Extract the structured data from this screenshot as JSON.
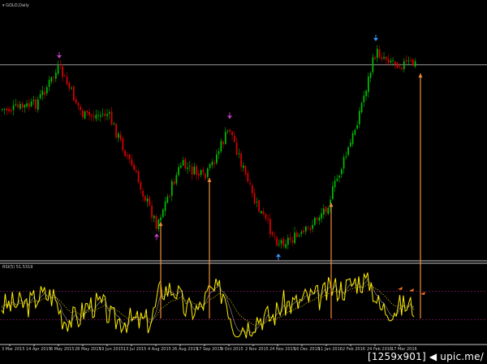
{
  "chart_data": [
    {
      "type": "candlestick",
      "symbol_label": "GOLD,Daily",
      "background": "#000000",
      "up_color": "#00c000",
      "down_color": "#e00000",
      "level_line_color": "#9a9a9a",
      "annotation_line_color": "#f08a3a",
      "x_tick_labels": [
        "3 Mar 2015",
        "14 Apr 2015",
        "6 May 2015",
        "28 May 2015",
        "19 Jun 2015",
        "13 Jul 2015",
        "4 Aug 2015",
        "26 Aug 2015",
        "17 Sep 2015",
        "9 Oct 2015",
        "2 Nov 2015",
        "24 Nov 2015",
        "16 Dec 2015",
        "11 Jan 2016",
        "2 Feb 2016",
        "24 Feb 2016",
        "17 Mar 2016"
      ],
      "close_path": [
        {
          "d": "3 Mar 2015",
          "c": 0.6
        },
        {
          "d": "14 Apr 2015",
          "c": 0.62
        },
        {
          "d": "6 May 2015",
          "c": 0.78
        },
        {
          "d": "28 May 2015",
          "c": 0.57
        },
        {
          "d": "19 Jun 2015",
          "c": 0.58
        },
        {
          "d": "13 Jul 2015",
          "c": 0.35
        },
        {
          "d": "4 Aug 2015",
          "c": 0.1
        },
        {
          "d": "26 Aug 2015",
          "c": 0.36
        },
        {
          "d": "17 Sep 2015",
          "c": 0.3
        },
        {
          "d": "9 Oct 2015",
          "c": 0.52
        },
        {
          "d": "2 Nov 2015",
          "c": 0.2
        },
        {
          "d": "24 Nov 2015",
          "c": 0.02
        },
        {
          "d": "16 Dec 2015",
          "c": 0.05
        },
        {
          "d": "11 Jan 2016",
          "c": 0.18
        },
        {
          "d": "2 Feb 2016",
          "c": 0.46
        },
        {
          "d": "24 Feb 2016",
          "c": 0.85
        },
        {
          "d": "17 Mar 2016",
          "c": 0.8
        }
      ],
      "swing_arrows": [
        {
          "d": "6 May 2015",
          "kind": "down",
          "color": "#c040c0"
        },
        {
          "d": "4 Aug 2015",
          "kind": "up",
          "color": "#c040c0"
        },
        {
          "d": "9 Oct 2015",
          "kind": "down",
          "color": "#c040c0"
        },
        {
          "d": "24 Nov 2015",
          "kind": "up",
          "color": "#3399ff"
        },
        {
          "d": "24 Feb 2016",
          "kind": "down",
          "color": "#3399ff"
        }
      ]
    },
    {
      "type": "line",
      "indicator_label": "RSI(5) 51.5319",
      "series": [
        {
          "name": "RSI(5)",
          "color": "#ffee00"
        }
      ],
      "overlay_colors": {
        "signal": "#bfbfbf",
        "trend": "#d4c000"
      },
      "levels": [
        30,
        70
      ],
      "ylim": [
        0,
        100
      ]
    }
  ],
  "watermark": "[1259x901]  ◀ upic.me/"
}
